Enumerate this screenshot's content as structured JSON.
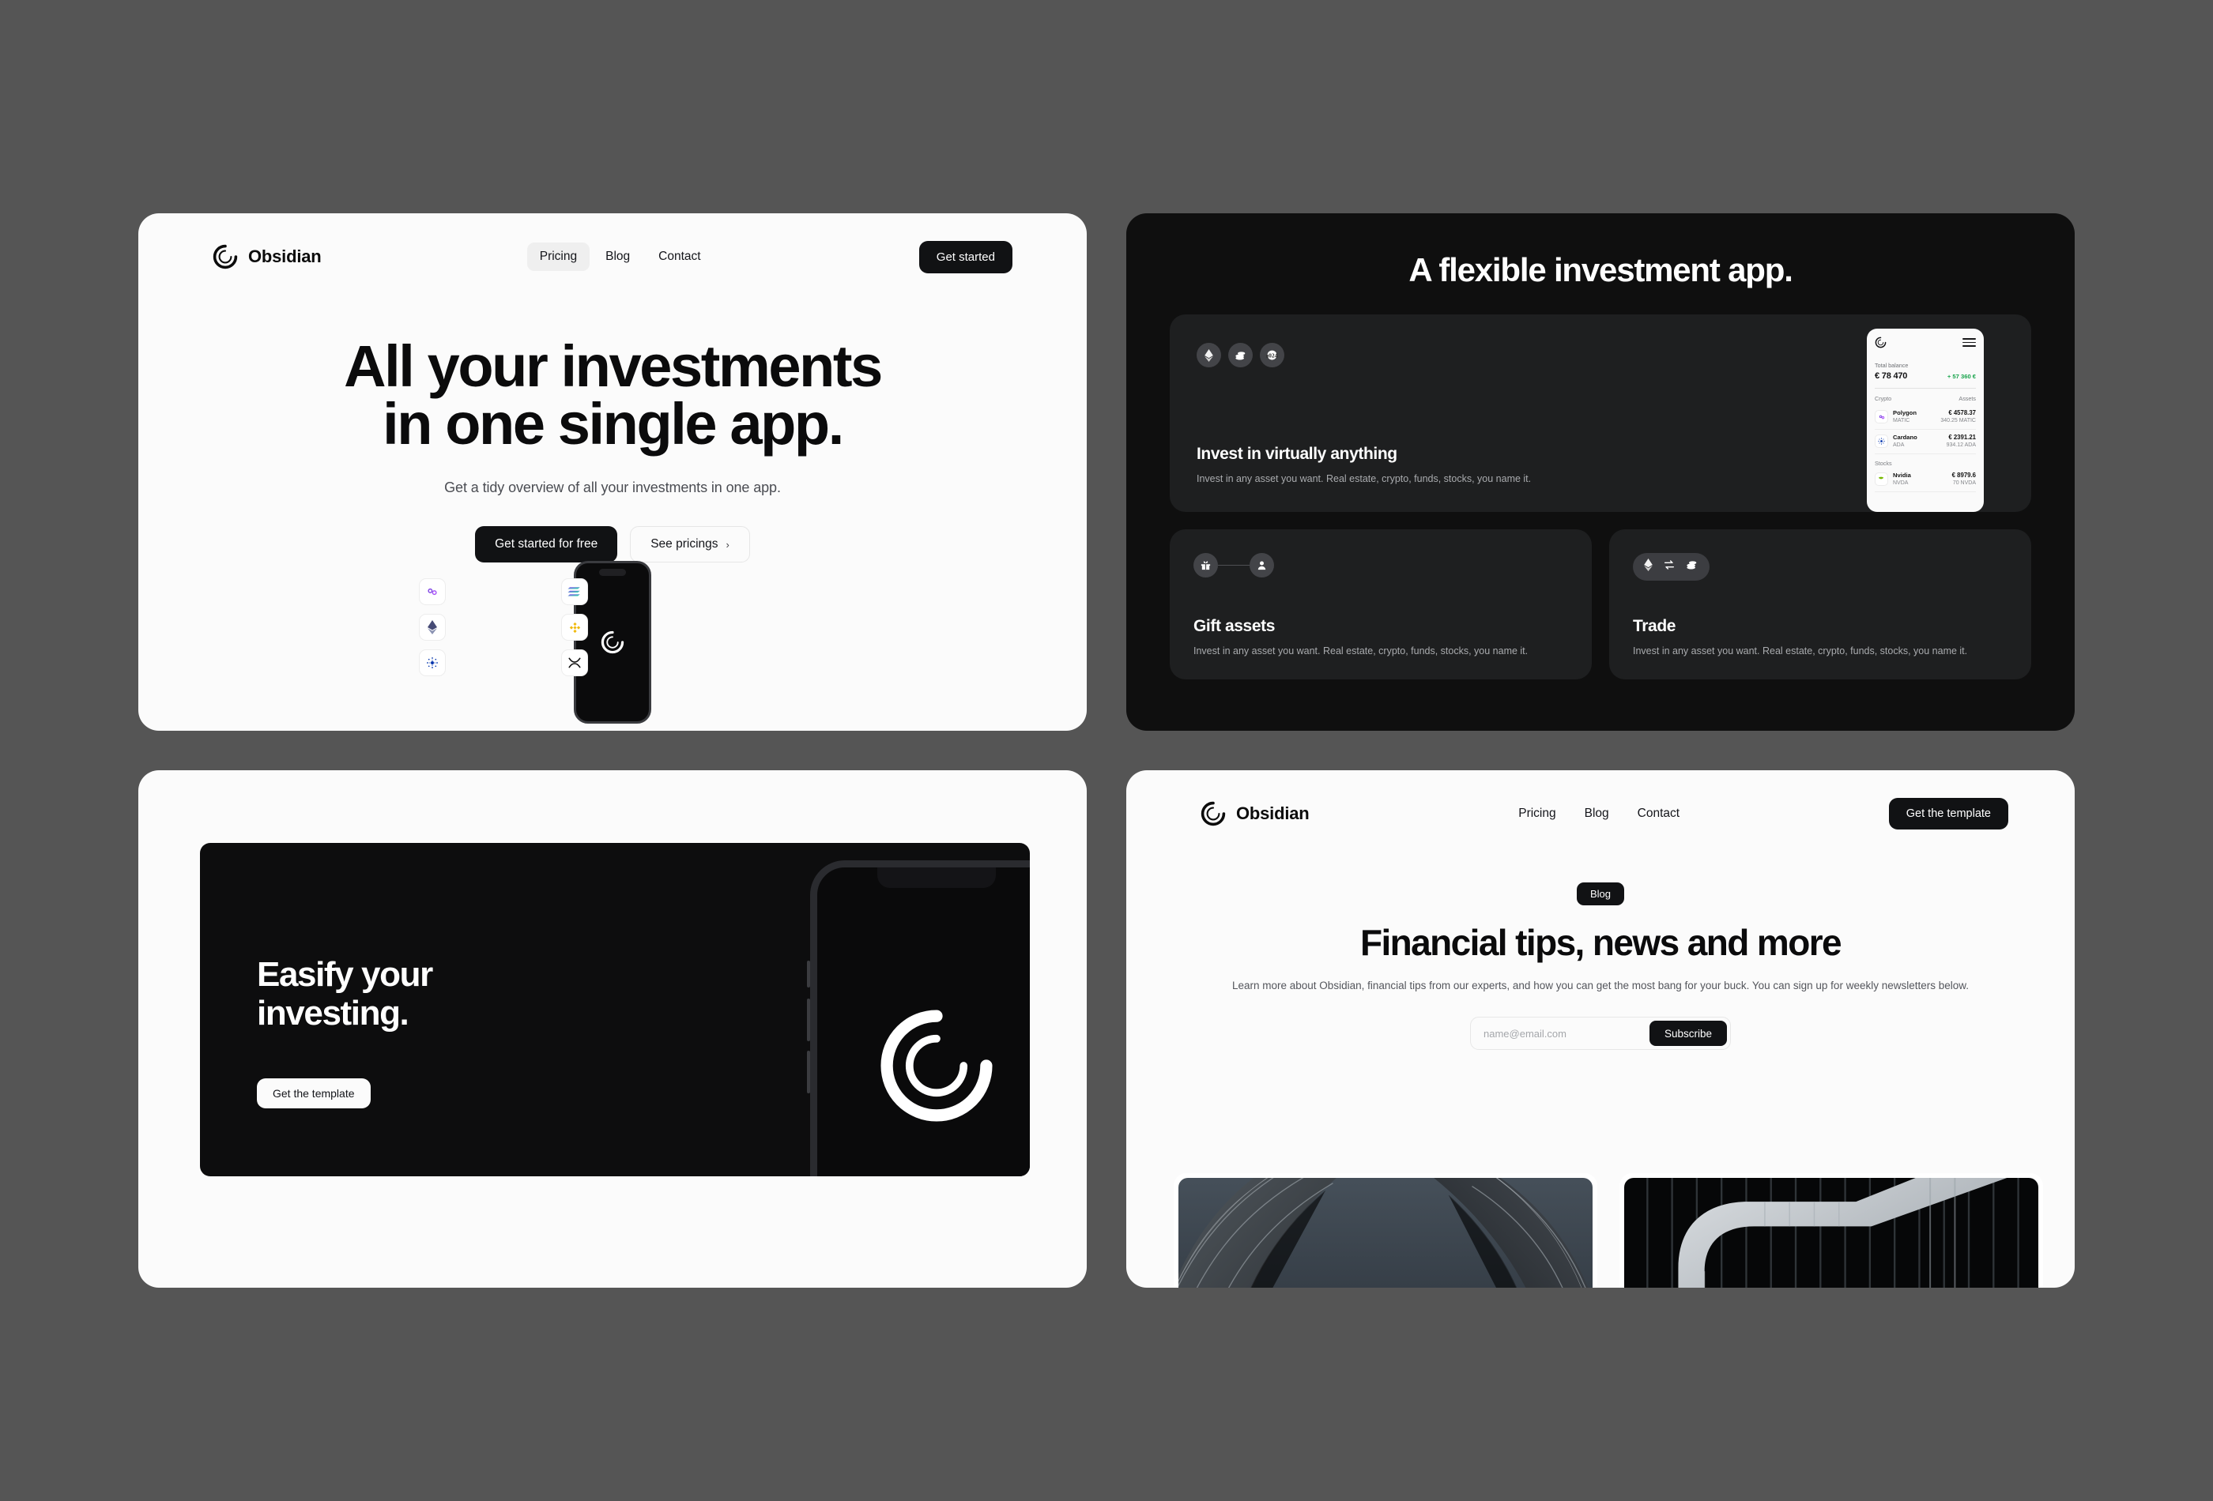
{
  "brand": {
    "name": "Obsidian",
    "logo_icon": "obsidian-ring-logo-icon"
  },
  "hero": {
    "nav": [
      {
        "label": "Pricing",
        "active": true
      },
      {
        "label": "Blog",
        "active": false
      },
      {
        "label": "Contact",
        "active": false
      }
    ],
    "cta_label": "Get started",
    "title_line1": "All your investments",
    "title_line2": "in one single app.",
    "subtitle": "Get a tidy overview of all your investments in one app.",
    "primary_button": "Get started for free",
    "secondary_button": "See pricings",
    "secondary_chevron": "›",
    "crypto_tiles_left": [
      "polygon-icon",
      "ethereum-icon",
      "cardano-icon"
    ],
    "crypto_tiles_right": [
      "solana-icon",
      "binance-icon",
      "ripple-icon"
    ]
  },
  "features": {
    "title": "A flexible investment app.",
    "invest": {
      "icons": [
        "ethereum-icon",
        "coins-stack-icon",
        "bitcoin-icon"
      ],
      "heading": "Invest in virtually anything",
      "body": "Invest in any asset you want. Real estate, crypto, funds, stocks, you name it."
    },
    "phone": {
      "logo_icon": "obsidian-ring-logo-icon",
      "menu_icon": "hamburger-menu-icon",
      "balance_label": "Total balance",
      "balance_value": "€ 78 470",
      "balance_gain": "+ 57 360 €",
      "col_left": "Crypto",
      "col_right": "Assets",
      "crypto_rows": [
        {
          "name": "Polygon",
          "ticker": "MATIC",
          "value": "€ 4578.37",
          "amount": "340.25 MATIC",
          "icon": "polygon-icon"
        },
        {
          "name": "Cardano",
          "ticker": "ADA",
          "value": "€ 2391.21",
          "amount": "934.12 ADA",
          "icon": "cardano-icon"
        }
      ],
      "stocks_label": "Stocks",
      "stock_rows": [
        {
          "name": "Nvidia",
          "ticker": "NVDA",
          "value": "€ 8979.6",
          "amount": "70 NVDA",
          "icon": "nvidia-icon"
        }
      ]
    },
    "gift": {
      "icons": [
        "gift-icon",
        "person-icon"
      ],
      "heading": "Gift assets",
      "body": "Invest in any asset you want. Real estate, crypto, funds, stocks, you name it."
    },
    "trade": {
      "icons": [
        "ethereum-icon",
        "swap-arrows-icon",
        "coins-stack-icon"
      ],
      "heading": "Trade",
      "body": "Invest in any asset you want. Real estate, crypto, funds, stocks, you name it."
    }
  },
  "easify": {
    "title_line1": "Easify your",
    "title_line2": "investing.",
    "cta_label": "Get the template",
    "phone_logo_icon": "obsidian-ring-logo-icon"
  },
  "blog": {
    "nav": [
      {
        "label": "Pricing",
        "active": false
      },
      {
        "label": "Blog",
        "active": false
      },
      {
        "label": "Contact",
        "active": false
      }
    ],
    "cta_label": "Get the template",
    "badge": "Blog",
    "title": "Financial tips, news and more",
    "body": "Learn more about Obsidian, financial tips from our experts, and how you can get the most bang for your buck. You can sign up for weekly newsletters below.",
    "email_placeholder": "name@email.com",
    "email_value": "",
    "subscribe_label": "Subscribe",
    "thumbnails": [
      {
        "name": "curved-concrete-architecture-photo"
      },
      {
        "name": "dark-staircase-architecture-photo"
      }
    ]
  },
  "colors": {
    "page_background": "#555555",
    "card_light": "#fbfbfb",
    "card_dark": "#0f0f0f",
    "panel_dark": "#1e1f20",
    "accent_dark": "#111214",
    "gain_green": "#16a34a"
  }
}
